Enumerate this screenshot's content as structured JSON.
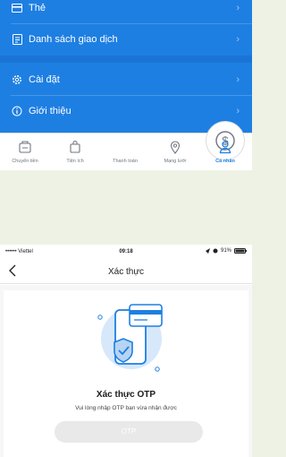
{
  "colors": {
    "primary": "#1e7fe2",
    "page_bg": "#eef2e4",
    "tab_inactive": "#6e7680"
  },
  "profile_menu": {
    "items": [
      {
        "label": "Thẻ",
        "icon": "card-icon"
      },
      {
        "label": "Danh sách giao dịch",
        "icon": "transaction-list-icon"
      },
      {
        "label": "Cài đặt",
        "icon": "gear-icon"
      },
      {
        "label": "Giới thiệu",
        "icon": "info-icon"
      }
    ],
    "chevron": "›"
  },
  "tabbar": {
    "tabs": [
      {
        "label": "Chuyển tiền",
        "icon": "transfer-icon",
        "active": false
      },
      {
        "label": "Tiện ích",
        "icon": "shopping-bag-icon",
        "active": false
      },
      {
        "label": "Thanh toán",
        "icon": "dollar-icon",
        "active": false
      },
      {
        "label": "Mạng lưới",
        "icon": "location-pin-icon",
        "active": false
      },
      {
        "label": "Cá nhân",
        "icon": "person-icon",
        "active": true
      }
    ]
  },
  "otp_screen": {
    "status": {
      "carrier": "•••••• Viettel",
      "time": "09:18",
      "battery": "91%"
    },
    "nav_title": "Xác thực",
    "heading": "Xác thực OTP",
    "subtitle": "Vui lòng nhập OTP bạn vừa nhận được",
    "button_label": "OTP"
  }
}
